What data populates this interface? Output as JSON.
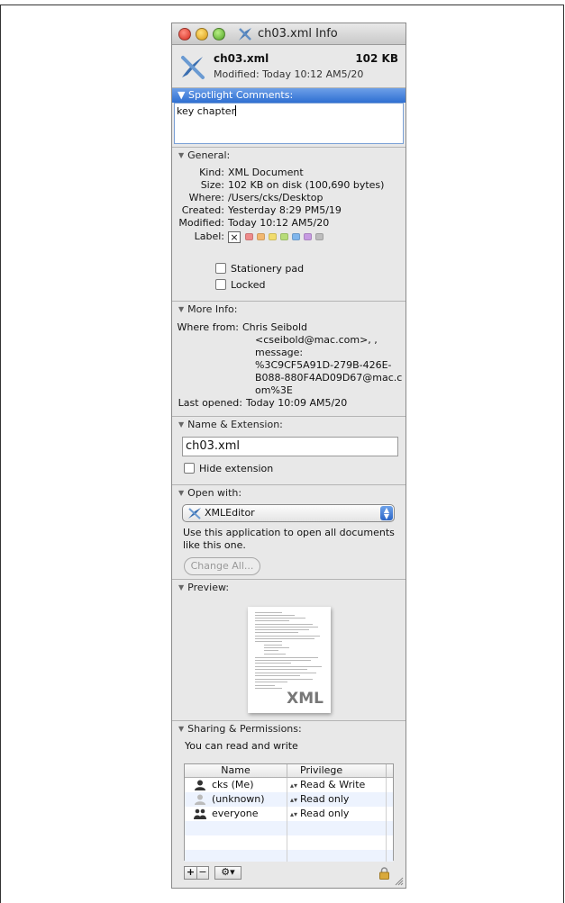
{
  "window": {
    "title": "ch03.xml Info"
  },
  "file": {
    "name": "ch03.xml",
    "size": "102 KB",
    "modified": "Modified: Today 10:12 AM5/20"
  },
  "spotlight": {
    "header": "Spotlight Comments:",
    "text": "key chapter"
  },
  "general": {
    "header": "General:",
    "rows": [
      {
        "key": "Kind:",
        "value": "XML Document"
      },
      {
        "key": "Size:",
        "value": "102 KB on disk (100,690 bytes)"
      },
      {
        "key": "Where:",
        "value": "/Users/cks/Desktop"
      },
      {
        "key": "Created:",
        "value": "Yesterday 8:29 PM5/19"
      },
      {
        "key": "Modified:",
        "value": "Today 10:12 AM5/20"
      }
    ],
    "label_key": "Label:",
    "label_none": "×",
    "label_colors": [
      "#ee8a8a",
      "#f2b870",
      "#f1dc6c",
      "#b7dc78",
      "#80b6ec",
      "#c79be2",
      "#bdbdbd"
    ],
    "stationery": "Stationery pad",
    "locked": "Locked"
  },
  "more_info": {
    "header": "More Info:",
    "where_from_key": "Where from:",
    "where_from_lines": [
      "Chris Seibold",
      "<cseibold@mac.com>, ,",
      "message:",
      "%3C9CF5A91D-279B-426E-",
      "B088-880F4AD09D67@mac.c",
      "om%3E"
    ],
    "last_opened_key": "Last opened:",
    "last_opened": "Today 10:09 AM5/20"
  },
  "name_ext": {
    "header": "Name & Extension:",
    "value": "ch03.xml",
    "hide_ext": "Hide extension"
  },
  "open_with": {
    "header": "Open with:",
    "app": "XMLEditor",
    "desc": "Use this application to open all documents like this one.",
    "change_all": "Change All..."
  },
  "preview": {
    "header": "Preview:",
    "watermark": "XML"
  },
  "sharing": {
    "header": "Sharing & Permissions:",
    "summary": "You can read and write",
    "col_name": "Name",
    "col_priv": "Privilege",
    "rows": [
      {
        "name": "cks (Me)",
        "privilege": "Read & Write",
        "icon": "user-icon"
      },
      {
        "name": "(unknown)",
        "privilege": "Read only",
        "icon": "unknown-user-icon"
      },
      {
        "name": "everyone",
        "privilege": "Read only",
        "icon": "group-icon"
      }
    ],
    "add": "+",
    "remove": "−",
    "gear": "⚙▾"
  }
}
